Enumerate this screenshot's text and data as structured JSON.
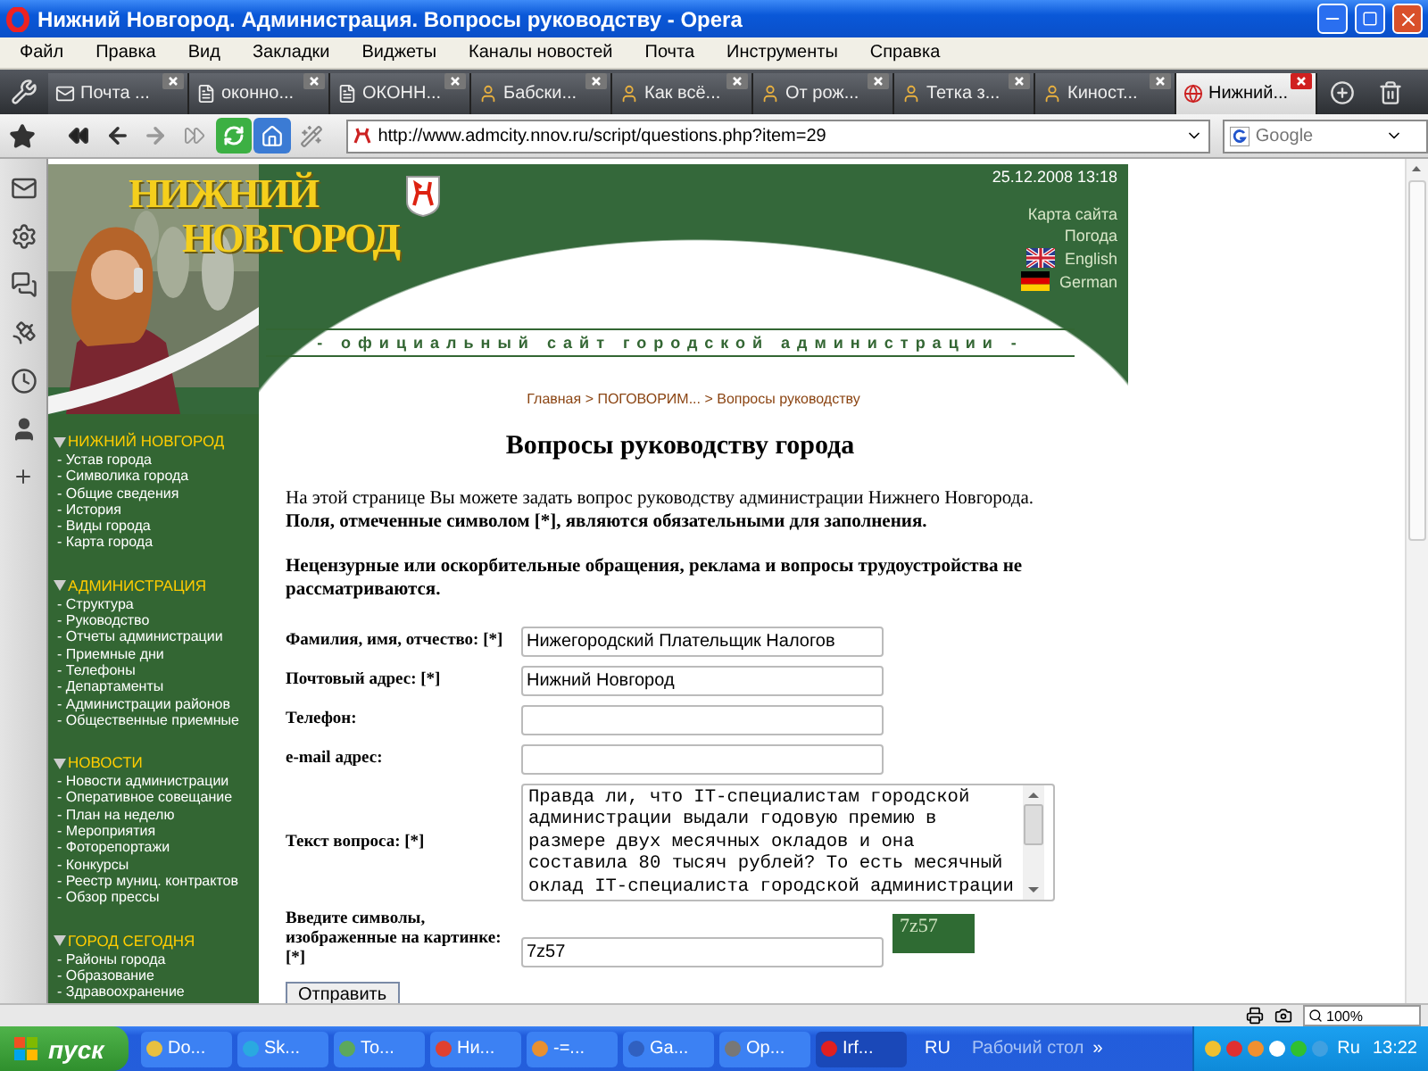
{
  "window": {
    "title": "Нижний Новгород. Администрация. Вопросы руководству - Opera"
  },
  "menu": [
    "Файл",
    "Правка",
    "Вид",
    "Закладки",
    "Виджеты",
    "Каналы новостей",
    "Почта",
    "Инструменты",
    "Справка"
  ],
  "tabs": [
    {
      "label": "Почта ...",
      "selected": false
    },
    {
      "label": "оконно...",
      "selected": false
    },
    {
      "label": "ОКОНН...",
      "selected": false
    },
    {
      "label": "Бабски...",
      "selected": false
    },
    {
      "label": "Как всё...",
      "selected": false
    },
    {
      "label": "От рож...",
      "selected": false
    },
    {
      "label": "Тетка з...",
      "selected": false
    },
    {
      "label": "Киност...",
      "selected": false
    },
    {
      "label": "Нижний...",
      "selected": true
    }
  ],
  "address": {
    "url": "http://www.admcity.nnov.ru/script/questions.php?item=29"
  },
  "search": {
    "placeholder": "Google"
  },
  "site": {
    "header": {
      "logo": [
        "НИЖНИЙ",
        "НОВГОРОД"
      ],
      "date": "25.12.2008 13:18",
      "links": [
        "Карта сайта",
        "Погода"
      ],
      "languages": [
        "English",
        "German"
      ],
      "tagline": "- официальный сайт городской администрации -",
      "breadcrumb": "Главная > ПОГОВОРИМ... > Вопросы руководству"
    },
    "nav": [
      {
        "title": "НИЖНИЙ НОВГОРОД",
        "items": [
          "- Устав города",
          "- Символика города",
          "- Общие сведения",
          "- История",
          "- Виды города",
          "- Карта города"
        ]
      },
      {
        "title": "АДМИНИСТРАЦИЯ",
        "items": [
          "- Структура",
          "- Руководство",
          "- Отчеты администрации",
          "- Приемные дни",
          "- Телефоны",
          "- Департаменты",
          "- Администрации районов",
          "- Общественные приемные"
        ]
      },
      {
        "title": "НОВОСТИ",
        "items": [
          "- Новости администрации",
          "- Оперативное совещание",
          "- План на неделю",
          "- Мероприятия",
          "- Фоторепортажи",
          "- Конкурсы",
          "- Реестр муниц. контрактов",
          "- Обзор прессы"
        ]
      },
      {
        "title": "ГОРОД СЕГОДНЯ",
        "items": [
          "- Районы города",
          "- Образование",
          "- Здравоохранение"
        ]
      }
    ],
    "content": {
      "heading": "Вопросы руководству города",
      "intro": "На этой странице Вы можете задать вопрос руководству администрации Нижнего Новгорода.",
      "required_note": "Поля, отмеченные символом [*], являются обязательными для заполнения.",
      "notice": "Нецензурные или оскорбительные обращения, реклама и вопросы трудоустройства не рассматриваются.",
      "fields": [
        {
          "kind": "text",
          "label": "Фамилия, имя, отчество: [*]",
          "value": "Нижегородский Плательщик Налогов"
        },
        {
          "kind": "text",
          "label": "Почтовый адрес: [*]",
          "value": "Нижний Новгород"
        },
        {
          "kind": "text",
          "label": "Телефон:"
        },
        {
          "kind": "text",
          "label": "e-mail адрес:"
        },
        {
          "kind": "textarea",
          "label": "Текст вопроса: [*]",
          "value": "Правда ли, что IT-специалистам городской администрации выдали годовую премию в размере двух месячных окладов и она составила 80 тысяч рублей? То есть месячный оклад IT-специалиста городской администрации"
        },
        {
          "kind": "captcha",
          "label": "Введите символы, изображенные на картинке: [*]",
          "value": "7z57",
          "captcha": "7z57"
        }
      ],
      "submit": "Отправить"
    }
  },
  "status": {
    "zoom": "100%"
  },
  "taskbar": {
    "start": "пуск",
    "tasks": [
      {
        "label": "Do...",
        "selected": false
      },
      {
        "label": "Sk...",
        "selected": false
      },
      {
        "label": "To...",
        "selected": false
      },
      {
        "label": "Ни...",
        "selected": false
      },
      {
        "label": "-=...",
        "selected": false
      },
      {
        "label": "Ga...",
        "selected": false
      },
      {
        "label": "Op...",
        "selected": false
      },
      {
        "label": "Irf...",
        "selected": true
      }
    ],
    "language": "RU",
    "toolbar": "Рабочий стол",
    "overflow": "»",
    "tray_language": "Ru",
    "clock": "13:22"
  }
}
